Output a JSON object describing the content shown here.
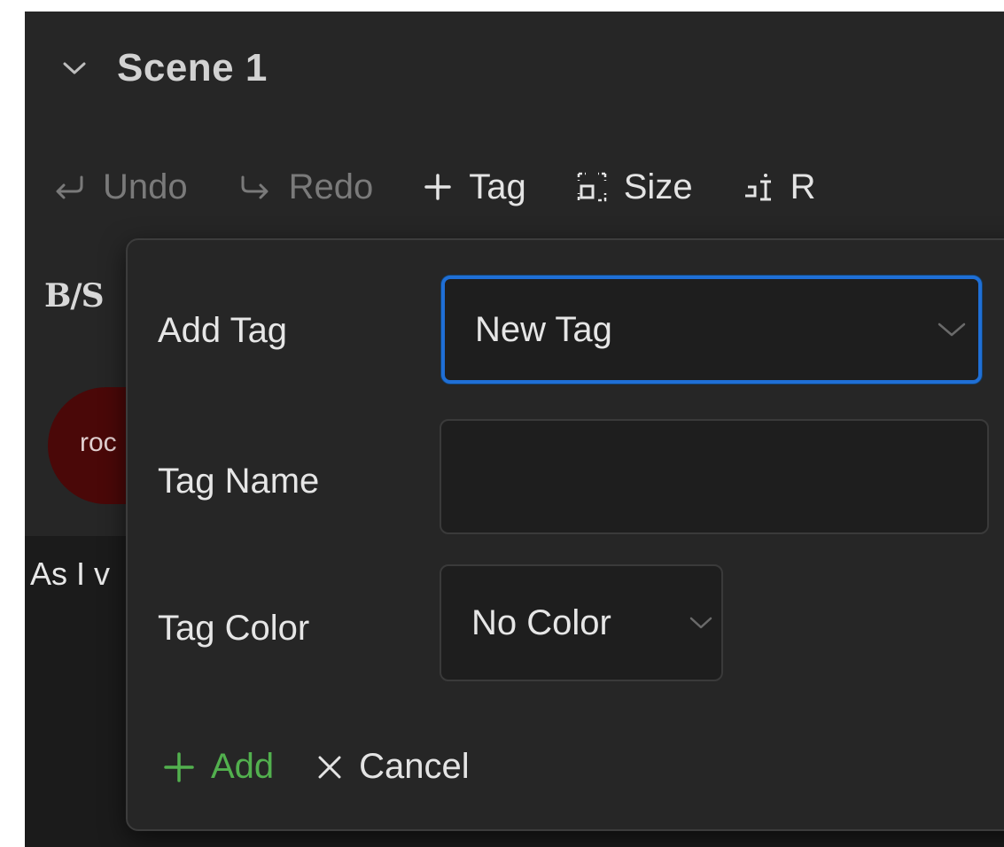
{
  "scene": {
    "title": "Scene 1",
    "chevron_icon": "chevron-down-icon"
  },
  "toolbar": {
    "undo_label": "Undo",
    "redo_label": "Redo",
    "tag_label": "Tag",
    "size_label": "Size",
    "fourth_label": "R"
  },
  "background": {
    "logo_text": "B/S",
    "tag_chip_text": "roc",
    "tag_chip_color": "#4a0808",
    "content_text": "As I v"
  },
  "popover": {
    "add_tag_label": "Add Tag",
    "add_tag_value": "New Tag",
    "tag_name_label": "Tag Name",
    "tag_name_value": "",
    "tag_color_label": "Tag Color",
    "tag_color_value": "No Color",
    "add_button_label": "Add",
    "cancel_button_label": "Cancel"
  },
  "colors": {
    "background": "#262626",
    "focus_border": "#1f6fd6",
    "add_green": "#52b04e",
    "disabled_text": "#7a7a7a"
  }
}
